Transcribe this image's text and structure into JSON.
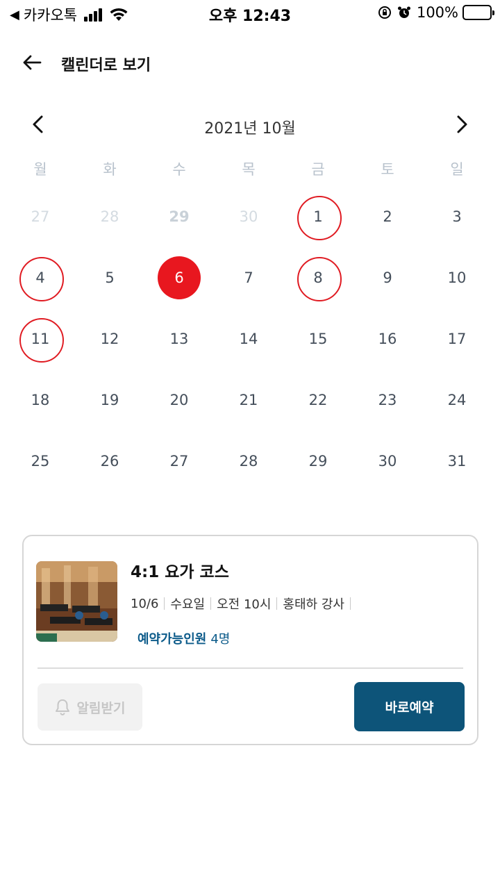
{
  "status_bar": {
    "back_app": "카카오톡",
    "time": "오후 12:43",
    "battery": "100%"
  },
  "header": {
    "title": "캘린더로 보기"
  },
  "calendar": {
    "month_label": "2021년 10월",
    "weekdays": [
      "월",
      "화",
      "수",
      "목",
      "금",
      "토",
      "일"
    ],
    "weeks": [
      [
        {
          "d": "27",
          "type": "other"
        },
        {
          "d": "28",
          "type": "other"
        },
        {
          "d": "29",
          "type": "other-bold"
        },
        {
          "d": "30",
          "type": "other"
        },
        {
          "d": "1",
          "type": "avail"
        },
        {
          "d": "2",
          "type": "normal"
        },
        {
          "d": "3",
          "type": "normal"
        }
      ],
      [
        {
          "d": "4",
          "type": "avail"
        },
        {
          "d": "5",
          "type": "normal"
        },
        {
          "d": "6",
          "type": "selected"
        },
        {
          "d": "7",
          "type": "normal"
        },
        {
          "d": "8",
          "type": "avail"
        },
        {
          "d": "9",
          "type": "normal"
        },
        {
          "d": "10",
          "type": "normal"
        }
      ],
      [
        {
          "d": "11",
          "type": "avail"
        },
        {
          "d": "12",
          "type": "normal"
        },
        {
          "d": "13",
          "type": "normal"
        },
        {
          "d": "14",
          "type": "normal"
        },
        {
          "d": "15",
          "type": "normal"
        },
        {
          "d": "16",
          "type": "normal"
        },
        {
          "d": "17",
          "type": "normal"
        }
      ],
      [
        {
          "d": "18",
          "type": "normal"
        },
        {
          "d": "19",
          "type": "normal"
        },
        {
          "d": "20",
          "type": "normal"
        },
        {
          "d": "21",
          "type": "normal"
        },
        {
          "d": "22",
          "type": "normal"
        },
        {
          "d": "23",
          "type": "normal"
        },
        {
          "d": "24",
          "type": "normal"
        }
      ],
      [
        {
          "d": "25",
          "type": "normal"
        },
        {
          "d": "26",
          "type": "normal"
        },
        {
          "d": "27",
          "type": "normal"
        },
        {
          "d": "28",
          "type": "normal"
        },
        {
          "d": "29",
          "type": "normal"
        },
        {
          "d": "30",
          "type": "normal"
        },
        {
          "d": "31",
          "type": "normal"
        }
      ]
    ]
  },
  "class_card": {
    "title": "4:1 요가 코스",
    "date": "10/6",
    "weekday": "수요일",
    "time": "오전 10시",
    "instructor": "홍태하 강사",
    "available_label": "예약가능인원",
    "available_count": "4명",
    "notify_label": "알림받기",
    "book_label": "바로예약"
  },
  "colors": {
    "accent_red": "#e8171f",
    "brand_blue": "#0d5479",
    "avail_text": "#0c5b8a"
  }
}
